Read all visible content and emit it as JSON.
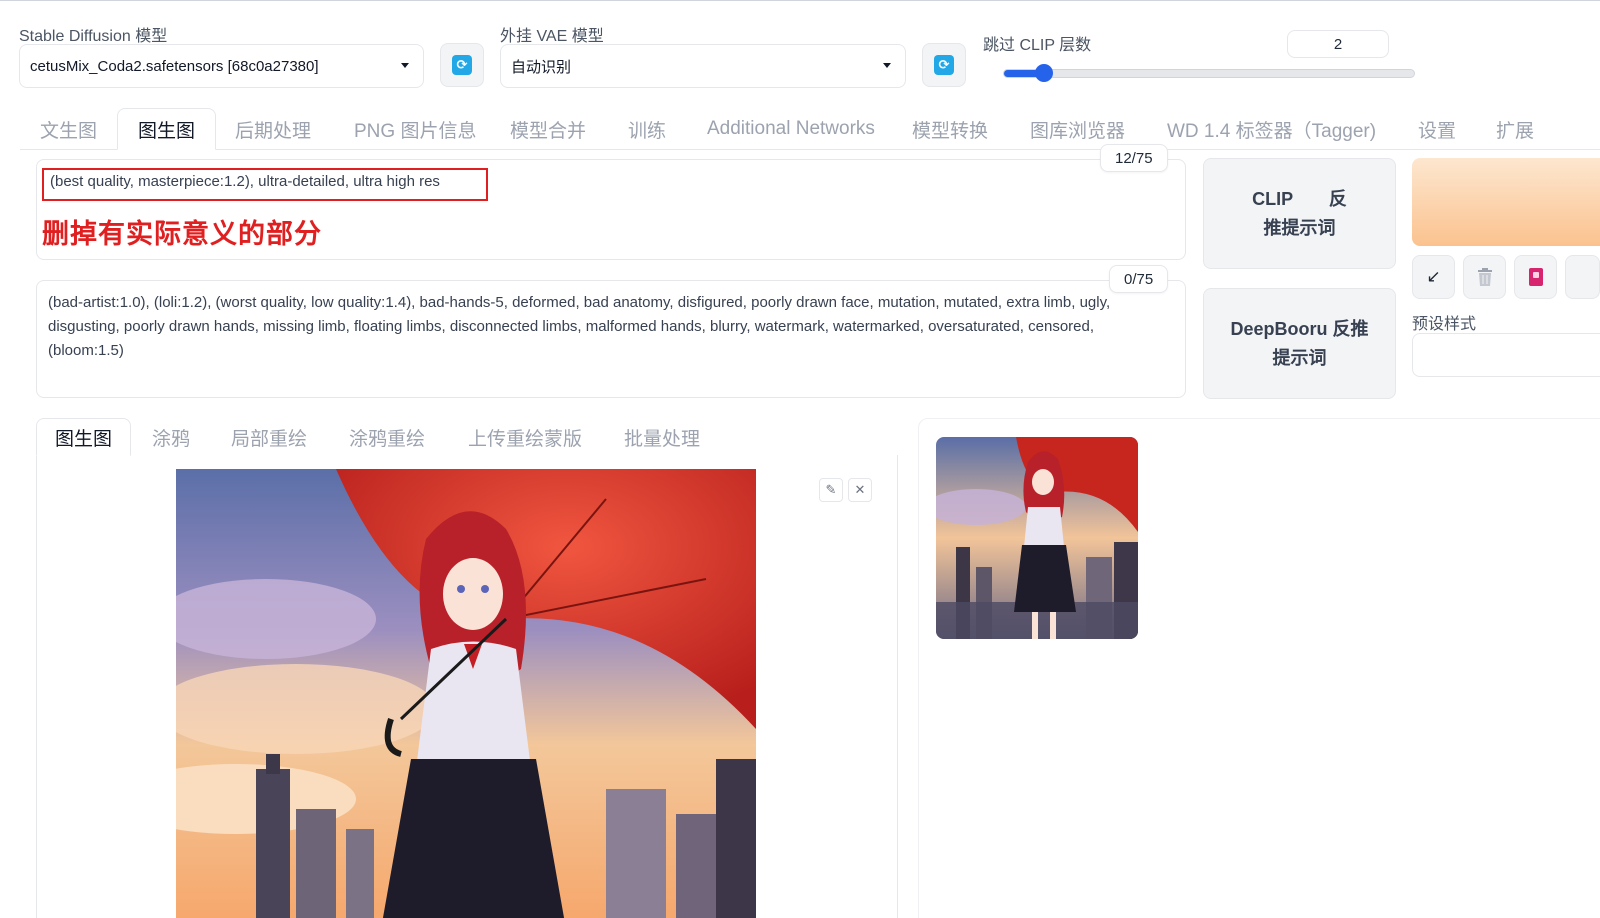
{
  "settings": {
    "sd_model_label": "Stable Diffusion 模型",
    "sd_model_value": "cetusMix_Coda2.safetensors [68c0a27380]",
    "vae_label": "外挂 VAE 模型",
    "vae_value": "自动识别",
    "clip_skip_label": "跳过 CLIP 层数",
    "clip_skip_value": "2",
    "clip_skip_fraction": 0.1
  },
  "main_tabs": [
    "文生图",
    "图生图",
    "后期处理",
    "PNG 图片信息",
    "模型合并",
    "训练",
    "Additional Networks",
    "模型转换",
    "图库浏览器",
    "WD 1.4 标签器（Tagger)",
    "设置",
    "扩展"
  ],
  "prompt": {
    "positive_text": "(best quality, masterpiece:1.2), ultra-detailed, ultra high res",
    "positive_count": "12/75",
    "annotation": "删掉有实际意义的部分",
    "negative_text": "(bad-artist:1.0), (loli:1.2), (worst quality, low quality:1.4), bad-hands-5, deformed, bad anatomy, disfigured, poorly drawn face, mutation, mutated, extra limb, ugly, disgusting, poorly drawn hands, missing limb, floating limbs, disconnected limbs, malformed hands, blurry, watermark, watermarked, oversaturated, censored, (bloom:1.5)",
    "negative_count": "0/75"
  },
  "side": {
    "clip_btn_line1": "CLIP　　反",
    "clip_btn_line2": "推提示词",
    "deepbooru_line1": "DeepBooru 反推",
    "deepbooru_line2": "提示词",
    "preset_label": "预设样式"
  },
  "sub_tabs": [
    "图生图",
    "涂鸦",
    "局部重绘",
    "涂鸦重绘",
    "上传重绘蒙版",
    "批量处理"
  ],
  "icons": {
    "refresh": "refresh-icon",
    "arrow": "↙",
    "trash": "🗑",
    "card": "▮",
    "edit": "✎",
    "close": "✕"
  },
  "colors": {
    "accent": "#2563eb",
    "refresh": "#22a8e6",
    "annotation": "#e02020",
    "generate_top": "#fde7cf",
    "generate_bottom": "#fbc28f"
  }
}
